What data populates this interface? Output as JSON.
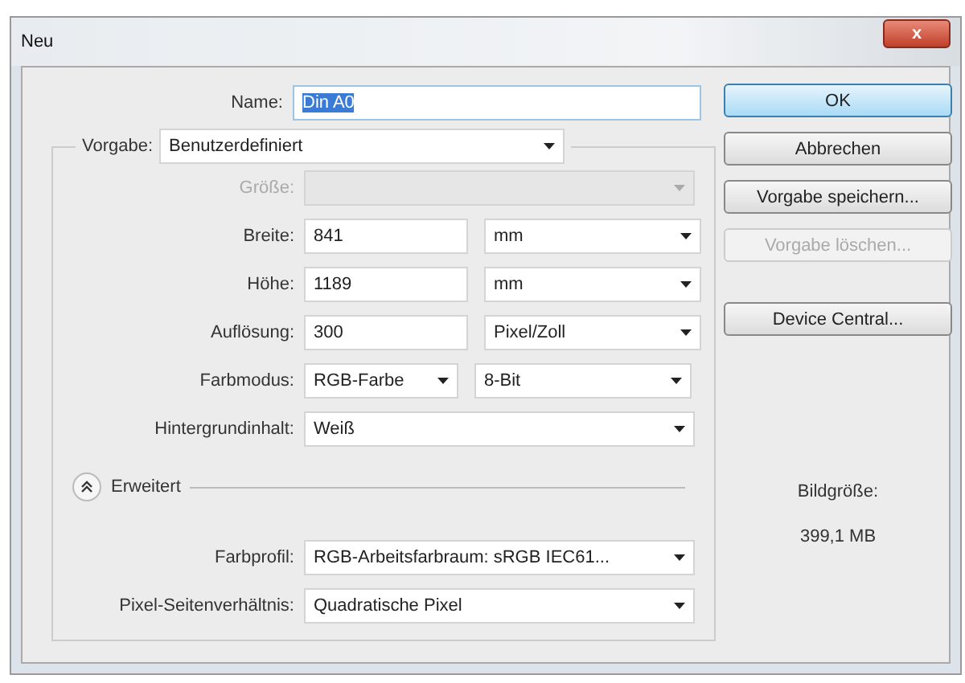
{
  "window": {
    "title": "Neu",
    "close": "x"
  },
  "name": {
    "label": "Name:",
    "value": "Din A0",
    "selected": true
  },
  "preset": {
    "label": "Vorgabe:",
    "value": "Benutzerdefiniert"
  },
  "fields": [
    {
      "kind": "select",
      "label": "Größe:",
      "disabled": true
    },
    {
      "kind": "input_select",
      "label": "Breite:",
      "value": "841",
      "unit": "mm",
      "disabled": false
    },
    {
      "kind": "input_select",
      "label": "Höhe:",
      "value": "1189",
      "unit": "mm",
      "disabled": false
    },
    {
      "kind": "input_select",
      "label": "Auflösung:",
      "value": "300",
      "unit": "Pixel/Zoll",
      "disabled": false
    },
    {
      "kind": "select_select",
      "label": "Farbmodus:",
      "value": "RGB-Farbe",
      "unit": "8-Bit",
      "disabled": false
    },
    {
      "kind": "select",
      "label": "Hintergrundinhalt:",
      "value": "Weiß",
      "disabled": false
    }
  ],
  "advanced": {
    "label": "Erweitert",
    "expanded": true,
    "fields": [
      {
        "label": "Farbprofil:",
        "value": "RGB-Arbeitsfarbraum:  sRGB IEC61..."
      },
      {
        "label": "Pixel-Seitenverhältnis:",
        "value": "Quadratische Pixel"
      }
    ]
  },
  "buttons": [
    {
      "label": "OK",
      "default": true,
      "disabled": false
    },
    {
      "label": "Abbrechen",
      "default": false,
      "disabled": false
    },
    {
      "label": "Vorgabe speichern...",
      "default": false,
      "disabled": false
    },
    {
      "label": "Vorgabe löschen...",
      "default": false,
      "disabled": true
    },
    {
      "label": "Device Central...",
      "default": false,
      "disabled": false
    }
  ],
  "image_size": {
    "label": "Bildgröße:",
    "value": "399,1 MB"
  }
}
